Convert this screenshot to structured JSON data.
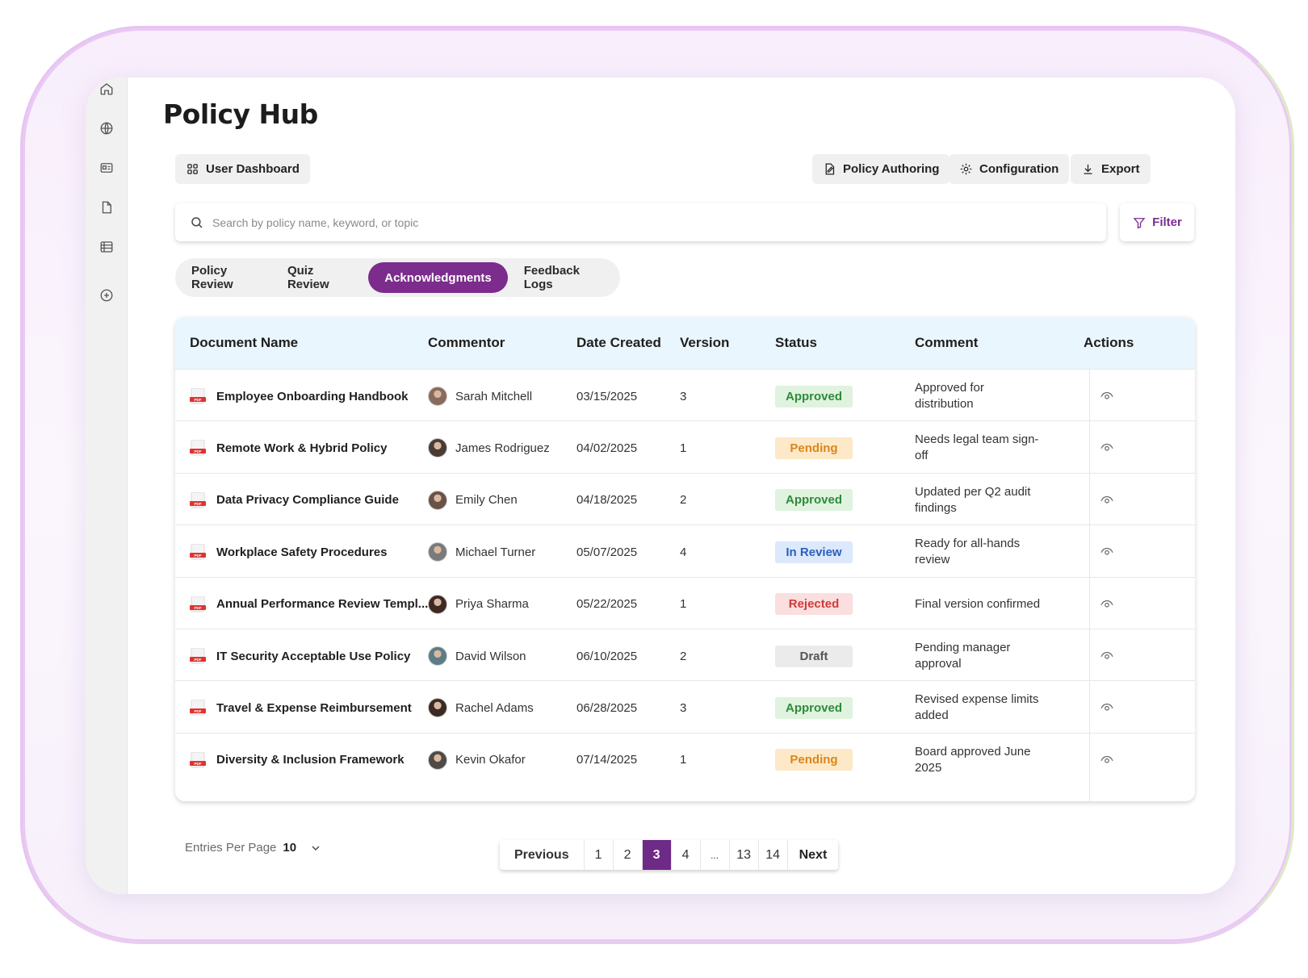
{
  "app": {
    "title": "Policy Hub"
  },
  "rail": {
    "icons": [
      "home-icon",
      "globe-icon",
      "id-card-icon",
      "document-icon",
      "table-icon",
      "add-circle-icon"
    ]
  },
  "toolbar": {
    "dashboard_label": "User Dashboard",
    "authoring_label": "Policy Authoring",
    "configuration_label": "Configuration",
    "export_label": "Export"
  },
  "search": {
    "placeholder": "Search by policy name, keyword, or topic",
    "value": ""
  },
  "filter": {
    "label": "Filter"
  },
  "tabs": [
    {
      "label": "Policy Review",
      "active": false
    },
    {
      "label": "Quiz Review",
      "active": false
    },
    {
      "label": "Acknowledgments",
      "active": true
    },
    {
      "label": "Feedback Logs",
      "active": false
    }
  ],
  "table": {
    "columns": [
      "Document Name",
      "Commentor",
      "Date Created",
      "Version",
      "Status",
      "Comment",
      "Actions"
    ],
    "rows": [
      {
        "document": "Employee Onboarding Handbook",
        "commentor": "Sarah Mitchell",
        "date": "03/15/2025",
        "version": "3",
        "status": "Approved",
        "comment": "Approved for distribution"
      },
      {
        "document": "Remote Work & Hybrid Policy",
        "commentor": "James Rodriguez",
        "date": "04/02/2025",
        "version": "1",
        "status": "Pending",
        "comment": "Needs legal team sign-off"
      },
      {
        "document": "Data Privacy Compliance Guide",
        "commentor": "Emily Chen",
        "date": "04/18/2025",
        "version": "2",
        "status": "Approved",
        "comment": "Updated per Q2 audit findings"
      },
      {
        "document": "Workplace Safety Procedures",
        "commentor": "Michael Turner",
        "date": "05/07/2025",
        "version": "4",
        "status": "In Review",
        "comment": "Ready for all-hands review"
      },
      {
        "document": "Annual Performance Review Templ...",
        "commentor": "Priya Sharma",
        "date": "05/22/2025",
        "version": "1",
        "status": "Rejected",
        "comment": "Final version confirmed"
      },
      {
        "document": "IT Security Acceptable Use Policy",
        "commentor": "David Wilson",
        "date": "06/10/2025",
        "version": "2",
        "status": "Draft",
        "comment": "Pending manager approval"
      },
      {
        "document": "Travel & Expense Reimbursement",
        "commentor": "Rachel Adams",
        "date": "06/28/2025",
        "version": "3",
        "status": "Approved",
        "comment": "Revised expense limits added"
      },
      {
        "document": "Diversity & Inclusion Framework",
        "commentor": "Kevin Okafor",
        "date": "07/14/2025",
        "version": "1",
        "status": "Pending",
        "comment": "Board approved June 2025"
      }
    ]
  },
  "status_colors": {
    "Approved": {
      "bg": "#dff3df",
      "fg": "#2f8a3a"
    },
    "Pending": {
      "bg": "#fde9c8",
      "fg": "#d9861a"
    },
    "In Review": {
      "bg": "#dce8fb",
      "fg": "#2b5fbf"
    },
    "Rejected": {
      "bg": "#fbdede",
      "fg": "#cf3b3b"
    },
    "Draft": {
      "bg": "#ebebeb",
      "fg": "#555555"
    }
  },
  "footer": {
    "entries_label": "Entries Per Page",
    "entries_value": "10",
    "pagination": {
      "previous": "Previous",
      "next": "Next",
      "pages": [
        "1",
        "2",
        "3",
        "4",
        "...",
        "13",
        "14"
      ],
      "current": "3"
    }
  },
  "accent": "#7b2c8c"
}
